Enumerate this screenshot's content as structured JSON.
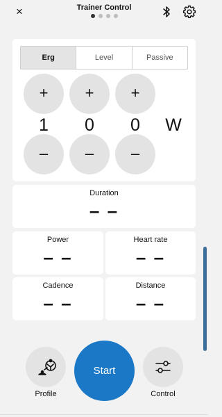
{
  "header": {
    "title": "Trainer Control",
    "close_icon": "×",
    "page_count": 4,
    "active_page": 0
  },
  "modes": {
    "tabs": [
      {
        "label": "Erg",
        "active": true
      },
      {
        "label": "Level",
        "active": false
      },
      {
        "label": "Passive",
        "active": false
      }
    ],
    "increment_symbol": "+",
    "decrement_symbol": "–",
    "digits": [
      "1",
      "0",
      "0"
    ],
    "unit": "W"
  },
  "metrics": {
    "duration": {
      "label": "Duration",
      "value": "– –"
    },
    "power": {
      "label": "Power",
      "value": "– –"
    },
    "heart_rate": {
      "label": "Heart rate",
      "value": "– –"
    },
    "cadence": {
      "label": "Cadence",
      "value": "– –"
    },
    "distance": {
      "label": "Distance",
      "value": "– –"
    }
  },
  "bottom": {
    "profile_label": "Profile",
    "start_label": "Start",
    "control_label": "Control"
  },
  "colors": {
    "accent": "#1a78c6",
    "button_bg": "#e3e3e4",
    "background": "#f2f2f2",
    "scrollbar": "#3b6e99"
  },
  "icons": {
    "close": "close-icon",
    "bluetooth": "bluetooth-icon",
    "settings": "gear-icon",
    "profile": "cyclist-profile-icon",
    "control": "sliders-icon"
  }
}
